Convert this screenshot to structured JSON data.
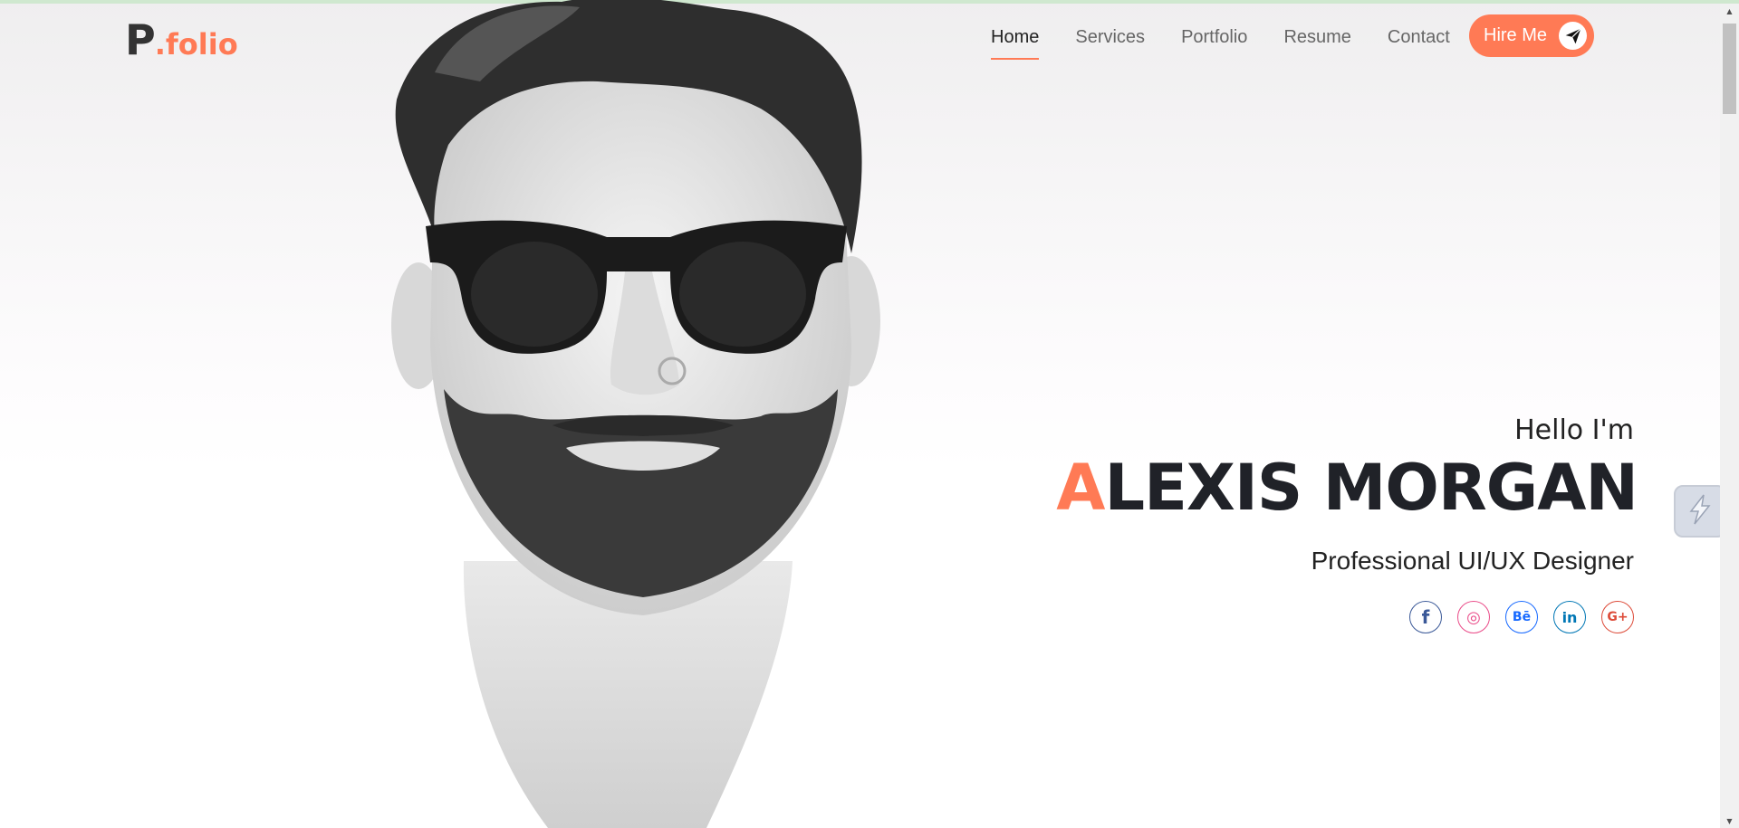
{
  "header": {
    "logo_main": "P",
    "logo_suffix": ".folio",
    "nav": [
      {
        "label": "Home",
        "active": true
      },
      {
        "label": "Services",
        "active": false
      },
      {
        "label": "Portfolio",
        "active": false
      },
      {
        "label": "Resume",
        "active": false
      },
      {
        "label": "Contact",
        "active": false
      }
    ],
    "hire_label": "Hire Me",
    "hire_icon": "paper-plane-icon"
  },
  "hero": {
    "greeting": "Hello I'm",
    "name_first_letter": "A",
    "name_rest": "LEXIS MORGAN",
    "role": "Professional UI/UX Designer"
  },
  "socials": [
    {
      "icon": "facebook-icon",
      "glyph": "f",
      "color": "#3b5998"
    },
    {
      "icon": "dribbble-icon",
      "glyph": "◎",
      "color": "#ea4c89"
    },
    {
      "icon": "behance-icon",
      "glyph": "Bē",
      "color": "#1769ff"
    },
    {
      "icon": "linkedin-icon",
      "glyph": "in",
      "color": "#0077b5"
    },
    {
      "icon": "google-plus-icon",
      "glyph": "G+",
      "color": "#dd4b39"
    }
  ],
  "colors": {
    "accent": "#ff7a55",
    "text_dark": "#202228",
    "nav_text": "#666666"
  },
  "side_widget_icon": "lightning-icon"
}
